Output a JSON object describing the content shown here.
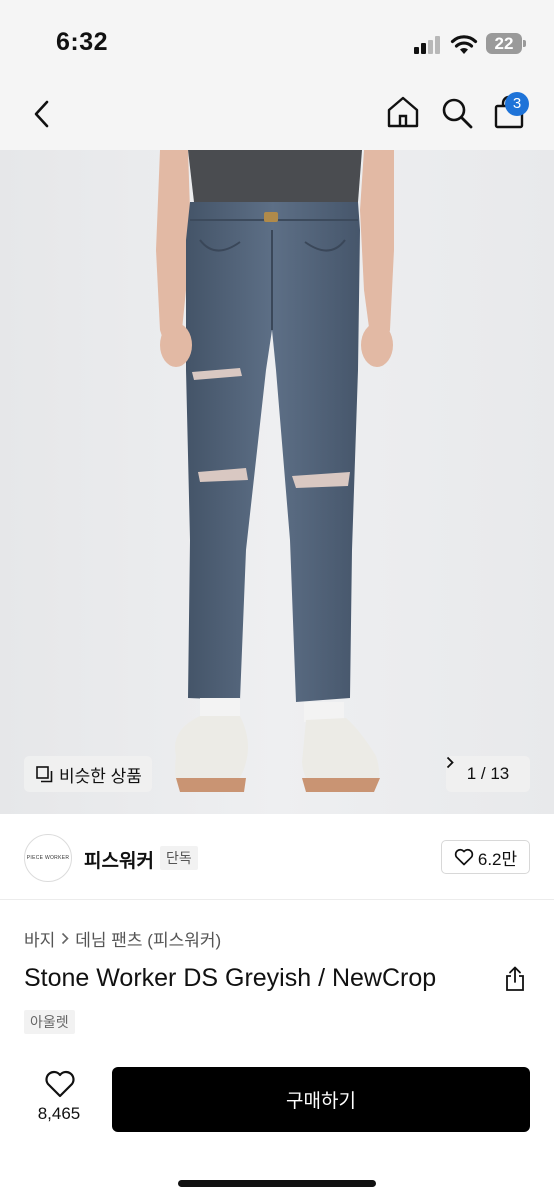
{
  "status_bar": {
    "time": "6:32",
    "battery": "22"
  },
  "nav": {
    "cart_count": "3"
  },
  "gallery": {
    "similar_label": "비슷한 상품",
    "pager_text": "1 / 13"
  },
  "brand": {
    "logo_text": "PIECE WORKER",
    "name": "피스워커",
    "tag": "단독",
    "likes": "6.2만"
  },
  "product": {
    "breadcrumb": [
      "바지",
      "데님 팬츠 (피스워커)"
    ],
    "title": "Stone Worker DS Greyish / NewCrop",
    "tag": "아울렛"
  },
  "bottom": {
    "favorite_count": "8,465",
    "buy_label": "구매하기"
  },
  "icons": [
    "back-icon",
    "home-icon",
    "search-icon",
    "shopping-bag-icon",
    "similar-items-icon",
    "chevron-right-icon",
    "heart-icon",
    "share-icon"
  ],
  "colors": {
    "badge": "#1e73d8",
    "buy_button": "#000000",
    "denim": "#51637a"
  }
}
